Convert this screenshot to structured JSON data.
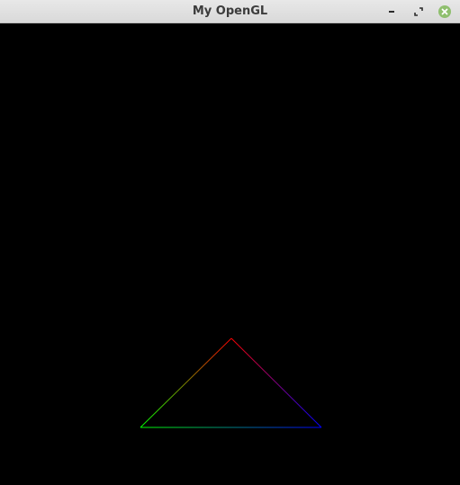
{
  "window": {
    "title": "My OpenGL"
  },
  "controls": [
    {
      "name": "minimize-button",
      "icon": "minimize-icon"
    },
    {
      "name": "maximize-button",
      "icon": "maximize-icon"
    },
    {
      "name": "close-button",
      "icon": "close-icon"
    }
  ],
  "scene": {
    "background_color": "#000000",
    "triangle": {
      "vertex_colors": {
        "top": "#ff0000",
        "bottom_left": "#00ff00",
        "bottom_right": "#0000ff"
      }
    }
  },
  "colors": {
    "titlebar": "#dedede",
    "close_button": "#8fbf6e"
  }
}
